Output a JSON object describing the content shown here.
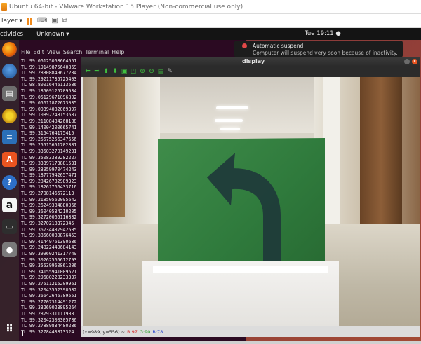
{
  "vmware": {
    "title": "Ubuntu 64-bit - VMware Workstation 15 Player (Non-commercial use only)",
    "player_menu": "layer ▾"
  },
  "ubuntu_panel": {
    "activities": "ctivities",
    "app_menu": "Unknown ▾",
    "clock": "Tue 19:11 ●"
  },
  "terminal": {
    "menu": [
      "File",
      "Edit",
      "View",
      "Search",
      "Terminal",
      "Help"
    ],
    "lines": [
      "TL 99.06125068664551",
      "TL 99.19149875640869",
      "TL 99.28308849677234",
      "TL 99.29211735725403",
      "TL 98.80016446113586",
      "TL 99.18509125709534",
      "TL 99.05129671096802",
      "TL 99.05611872673035",
      "TL 99.00394082069397",
      "TL 99.10892248153687",
      "TL 99.21108484268188",
      "TL 99.14004200665741",
      "TL 99.3154764175415",
      "TL 99.25575256347656",
      "TL 99.25515651702881",
      "TL 99.33503270149231",
      "TL 99.35083389282227",
      "TL 99.33397173881531",
      "TL 99.23959970474243",
      "TL 99.18777942657471",
      "TL 99.28426782989323",
      "TL 99.18261766433716",
      "TL 99.2708146572113",
      "TL 99.21850562095642",
      "TL 99.26249384880066",
      "TL 99.36040534210205",
      "TL 99.32720065116882",
      "TL 99.3270218372345",
      "TL 99.36734437942505",
      "TL 99.38560080876453",
      "TL 99.41449761390686",
      "TL 99.24822449684143",
      "TL 99.39960241317749",
      "TL 99.30262565612793",
      "TL 99.35539960861206",
      "TL 99.34155941009521",
      "TL 99.29680228233337",
      "TL 99.27511215209961",
      "TL 99.32043552398682",
      "TL 99.36642646789551",
      "TL 99.27707314491272",
      "TL 99.33269023895264",
      "TL 99.2879331111908",
      "TL 99.32042300305786",
      "TL 99.27889834480286",
      "TL 99.3278443813324"
    ]
  },
  "notification": {
    "title": "Automatic suspend",
    "body": "Computer will suspend very soon because of inactivity."
  },
  "display_window": {
    "title": "display",
    "status": {
      "coords": "(x=989, y=556) ~",
      "r": "R:97",
      "g": "G:90",
      "b": "B:78"
    }
  }
}
